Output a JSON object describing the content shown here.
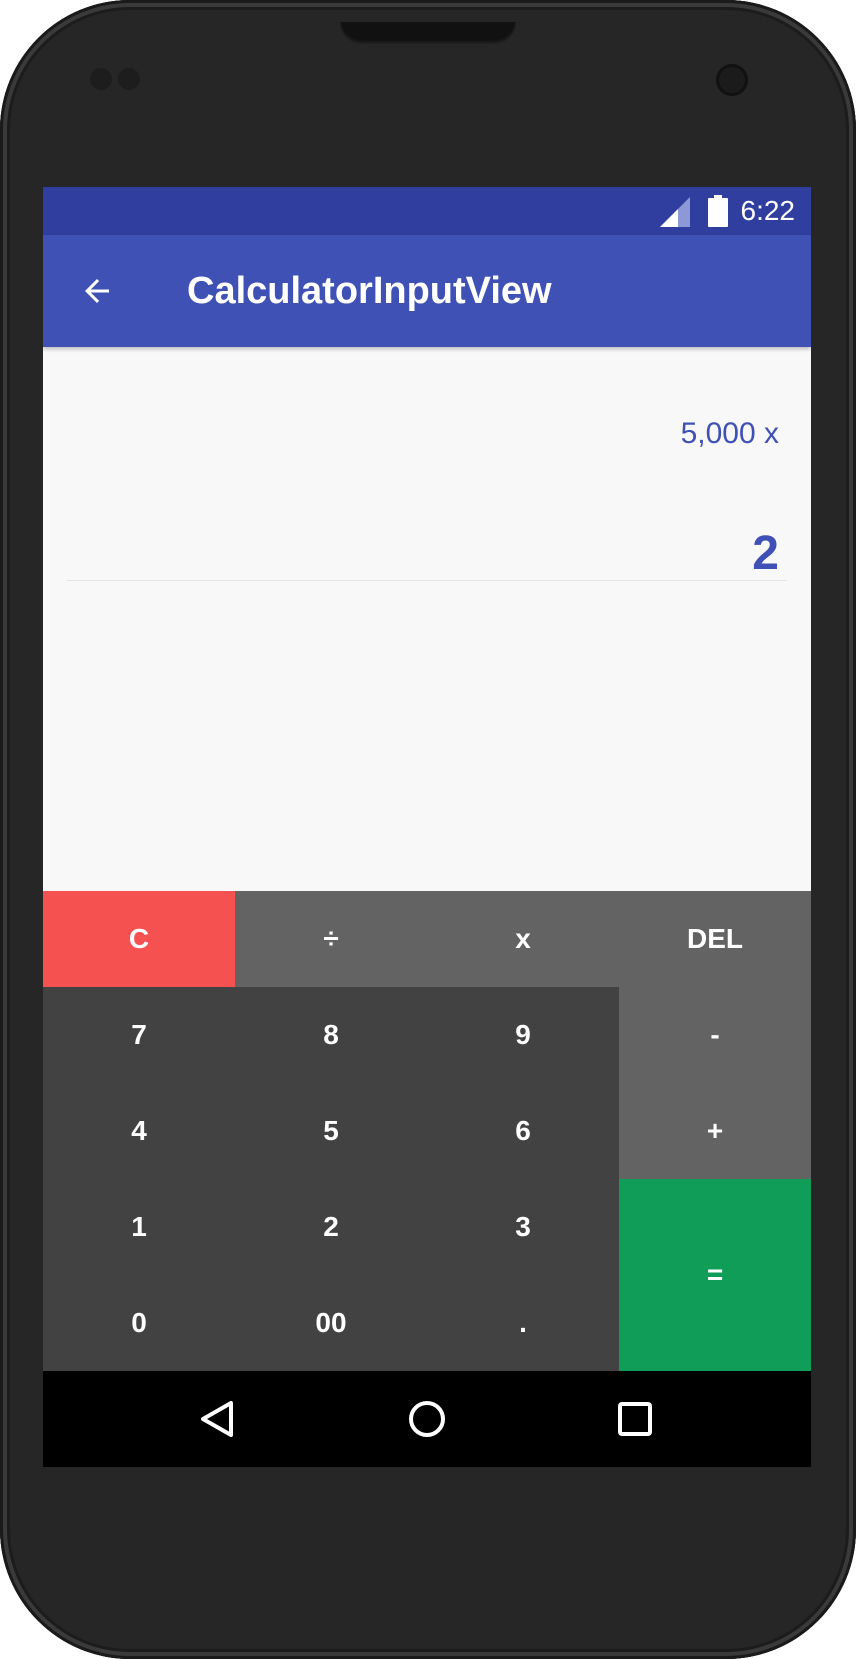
{
  "status_bar": {
    "time": "6:22",
    "icons": [
      "signal-icon",
      "battery-icon"
    ]
  },
  "app_bar": {
    "title": "CalculatorInputView",
    "back_icon": "arrow-back-icon"
  },
  "display": {
    "expression": "5,000 x",
    "current_value": "2"
  },
  "keypad": {
    "clear": "C",
    "divide": "÷",
    "multiply": "x",
    "delete": "DEL",
    "seven": "7",
    "eight": "8",
    "nine": "9",
    "minus": "-",
    "four": "4",
    "five": "5",
    "six": "6",
    "plus": "+",
    "one": "1",
    "two": "2",
    "three": "3",
    "equals": "=",
    "zero": "0",
    "double_zero": "00",
    "decimal": "."
  },
  "nav_bar": {
    "icons": [
      "back-triangle-icon",
      "home-circle-icon",
      "recents-square-icon"
    ]
  },
  "colors": {
    "status_bar": "#303f9f",
    "app_bar": "#3f51b5",
    "accent_text": "#3f51b5",
    "clear_key": "#f55151",
    "equals_key": "#0f9d58",
    "operator_key": "#636363",
    "digit_key": "#424242"
  }
}
